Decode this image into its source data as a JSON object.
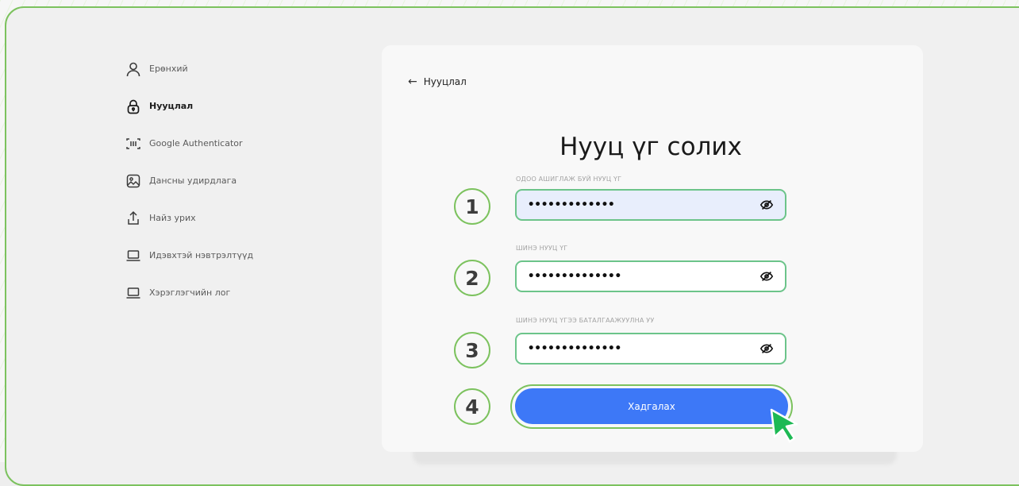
{
  "sidebar": {
    "items": [
      {
        "label": "Ерөнхий",
        "icon": "user-icon"
      },
      {
        "label": "Нууцлал",
        "icon": "lock-icon",
        "active": true
      },
      {
        "label": "Google Authenticator",
        "icon": "scan-icon"
      },
      {
        "label": "Дансны удирдлага",
        "icon": "image-icon"
      },
      {
        "label": "Найз урих",
        "icon": "share-icon"
      },
      {
        "label": "Идэвхтэй нэвтрэлтүүд",
        "icon": "laptop-icon"
      },
      {
        "label": "Хэрэглэгчийн лог",
        "icon": "laptop-icon"
      }
    ]
  },
  "main": {
    "back_label": "Нууцлал",
    "title": "Нууц үг солих",
    "fields": [
      {
        "label": "ОДОО АШИГЛАЖ БУЙ НУУЦ ҮГ",
        "value": "•••••••••••••",
        "step": "1"
      },
      {
        "label": "ШИНЭ НУУЦ ҮГ",
        "value": "••••••••••••••",
        "step": "2"
      },
      {
        "label": "ШИНЭ НУУЦ ҮГЭЭ БАТАЛГААЖУУЛНА УУ",
        "value": "••••••••••••••",
        "step": "3"
      }
    ],
    "save_step": "4",
    "save_label": "Хадгалах"
  },
  "colors": {
    "accent": "#3d78f7",
    "highlight_green": "#7cc25e",
    "input_border": "#6cc48a",
    "cursor": "#1db954"
  }
}
